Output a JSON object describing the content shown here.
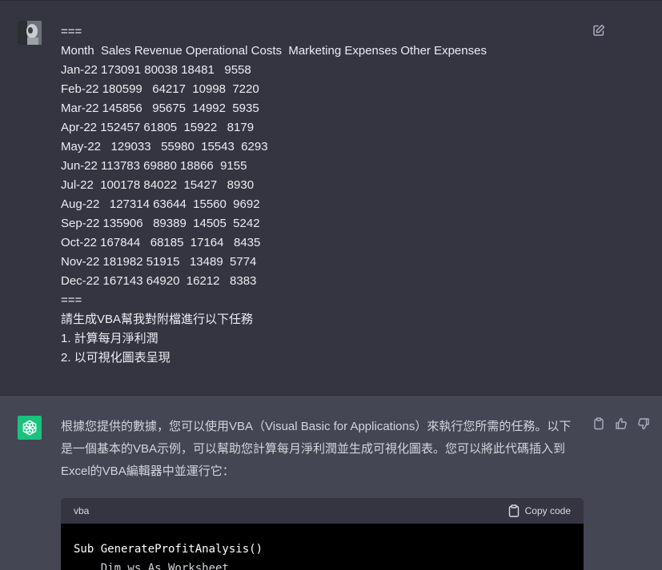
{
  "user_message": {
    "lines": [
      "===",
      "Month  Sales Revenue Operational Costs  Marketing Expenses Other Expenses",
      "Jan-22 173091 80038 18481   9558",
      "Feb-22 180599   64217  10998  7220",
      "Mar-22 145856   95675  14992  5935",
      "Apr-22 152457 61805  15922   8179",
      "May-22   129033   55980  15543  6293",
      "Jun-22 113783 69880 18866  9155",
      "Jul-22  100178 84022  15427   8930",
      "Aug-22   127314 63644  15560  9692",
      "Sep-22 135906   89389  14505  5242",
      "Oct-22 167844   68185  17164   8435",
      "Nov-22 181982 51915   13489  5774",
      "Dec-22 167143 64920  16212   8383",
      "===",
      "請生成VBA幫我對附檔進行以下任務",
      "1. 計算每月淨利潤",
      "2. 以可視化圖表呈現"
    ]
  },
  "assistant_message": {
    "text": "根據您提供的數據，您可以使用VBA（Visual Basic for Applications）來執行您所需的任務。以下是一個基本的VBA示例，可以幫助您計算每月淨利潤並生成可視化圖表。您可以將此代碼插入到Excel的VBA編輯器中並運行它：",
    "code_block": {
      "language": "vba",
      "copy_label": "Copy code",
      "lines": [
        "Sub GenerateProfitAnalysis()",
        "    Dim ws As Worksheet"
      ]
    }
  },
  "colors": {
    "user_bg": "#343541",
    "assistant_bg": "#444654",
    "gpt_avatar": "#19c37d",
    "code_bg": "#000000"
  }
}
